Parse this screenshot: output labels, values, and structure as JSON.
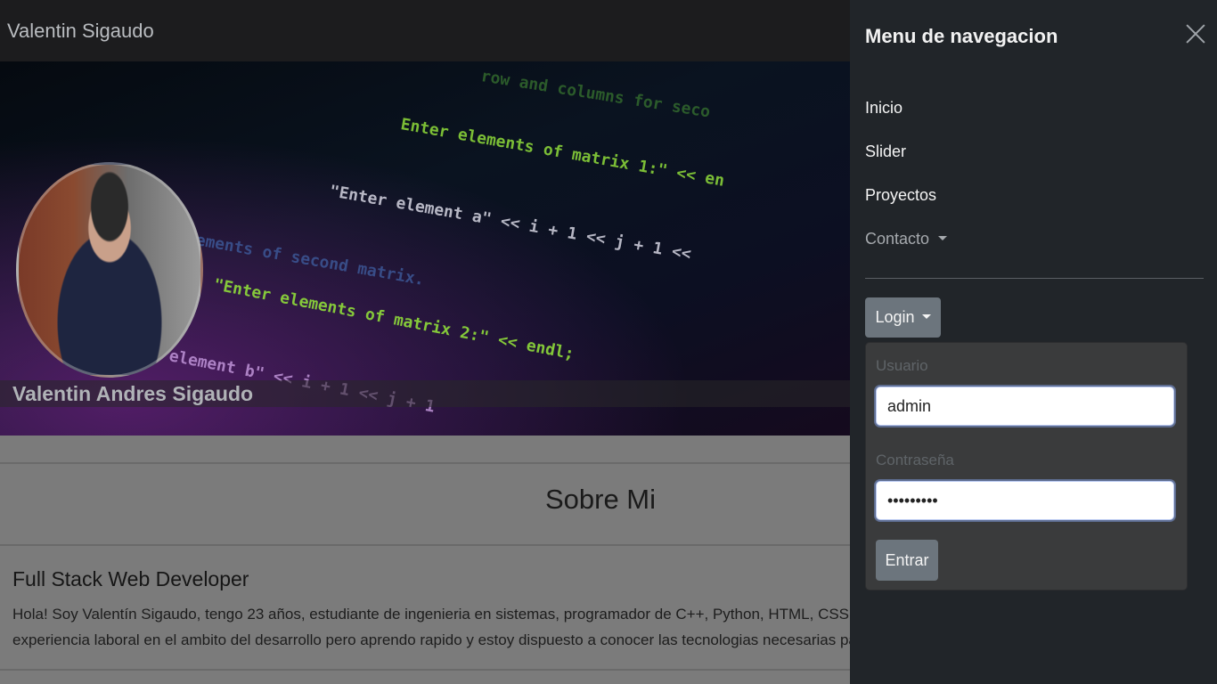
{
  "navbar": {
    "brand": "Valentin Sigaudo"
  },
  "hero": {
    "name": "Valentin Andres Sigaudo",
    "code_lines": [
      "row and columns for seco",
      "Enter elements of matrix 1:\" << en",
      "\"Enter element a\" << i + 1 << j + 1 << ",
      "ements of second matrix.",
      "\"Enter elements of matrix 2:\" << endl;",
      "element b\" << i + 1 << j + 1"
    ]
  },
  "about": {
    "title": "Sobre Mi",
    "role": "Full Stack Web Developer",
    "bio_line1": "Hola! Soy Valentín Sigaudo, tengo 23 años, estudiante de ingenieria en sistemas, programador de C++, Python, HTML, CSS, JS y o",
    "bio_line2": "experiencia laboral en el ambito del desarrollo pero aprendo rapido y estoy dispuesto a conocer las tecnologias necesarias para t"
  },
  "offcanvas": {
    "title": "Menu de navegacion",
    "nav": [
      {
        "label": "Inicio"
      },
      {
        "label": "Slider"
      },
      {
        "label": "Proyectos"
      },
      {
        "label": "Contacto"
      }
    ],
    "login_label": "Login",
    "form": {
      "user_label": "Usuario",
      "user_value": "admin",
      "pass_label": "Contraseña",
      "pass_value": "•••••••••",
      "submit_label": "Entrar"
    }
  },
  "colors": {
    "panel_bg": "#212529",
    "button_bg": "#6c757d",
    "code_green": "#7ed321",
    "code_pink": "#e04fb0",
    "code_orange": "#f5a623"
  }
}
